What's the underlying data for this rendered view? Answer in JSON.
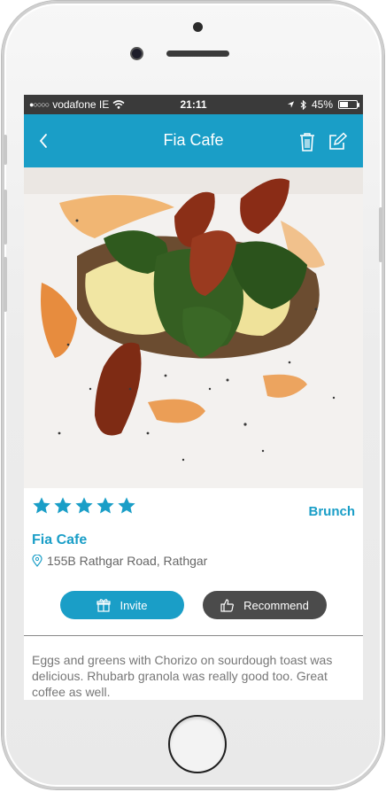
{
  "status_bar": {
    "signal_dots": "●○○○○",
    "carrier": "vodafone IE",
    "time": "21:11",
    "battery_percent": "45%",
    "battery_level": 0.45
  },
  "nav": {
    "title": "Fia Cafe",
    "back_icon": "chevron-left-icon",
    "delete_icon": "trash-icon",
    "edit_icon": "edit-icon"
  },
  "place": {
    "rating_stars": 5,
    "category": "Brunch",
    "name": "Fia Cafe",
    "address": "155B Rathgar Road, Rathgar"
  },
  "actions": {
    "invite_label": "Invite",
    "recommend_label": "Recommend"
  },
  "review": {
    "text": "Eggs and greens with Chorizo on sourdough toast was delicious. Rhubarb granola was really good too. Great coffee as well."
  },
  "colors": {
    "accent": "#1a9ec7",
    "recommend_button": "#4b4b4b",
    "status_bar": "#3a3a3a"
  }
}
